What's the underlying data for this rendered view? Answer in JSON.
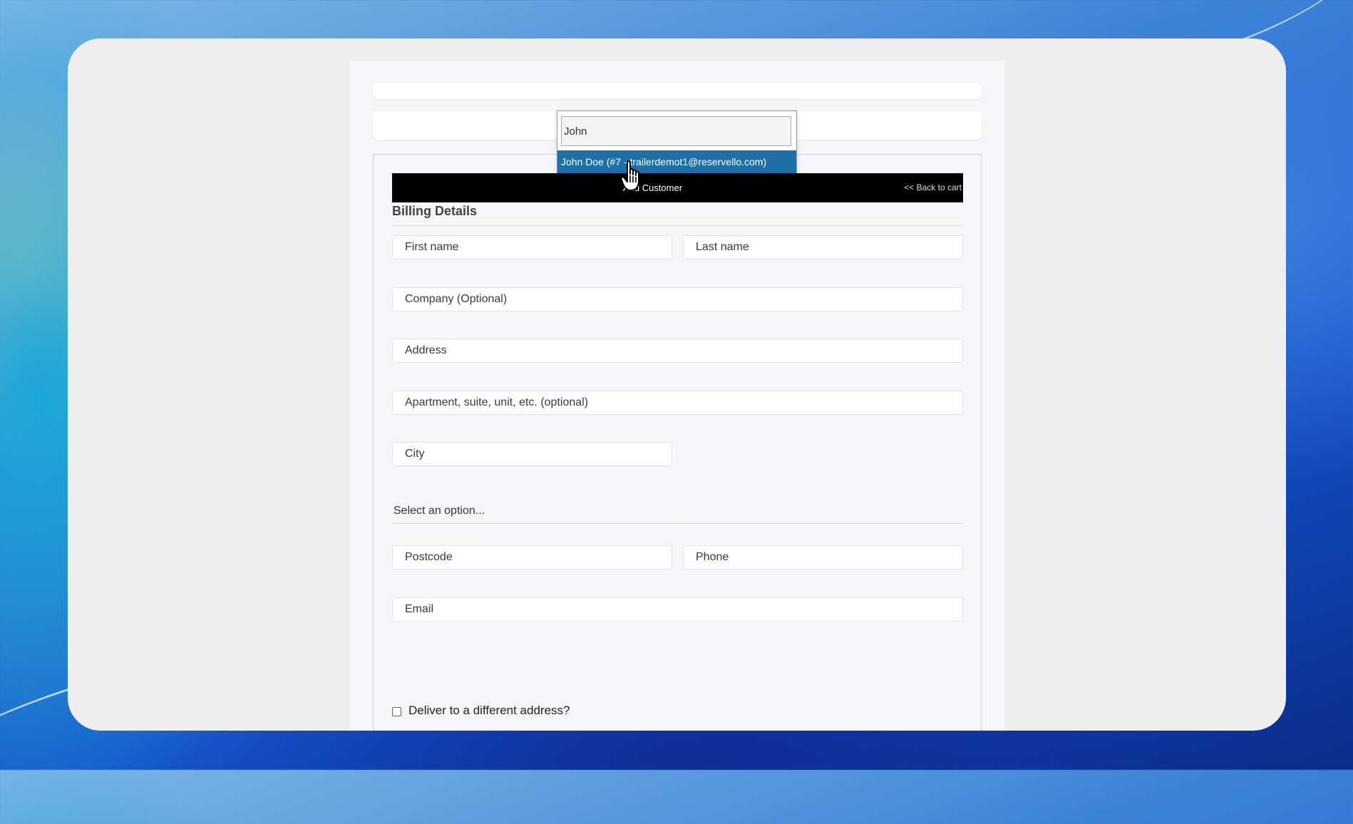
{
  "toolbar": {
    "add_customer_label": "Add Customer",
    "back_to_cart_label": "<< Back to cart"
  },
  "billing": {
    "title": "Billing Details",
    "first_name_placeholder": "First name",
    "last_name_placeholder": "Last name",
    "company_placeholder": "Company (Optional)",
    "address_placeholder": "Address",
    "apartment_placeholder": "Apartment, suite, unit, etc. (optional)",
    "city_placeholder": "City",
    "select_option_label": "Select an option...",
    "postcode_placeholder": "Postcode",
    "phone_placeholder": "Phone",
    "email_placeholder": "Email",
    "deliver_label": "Deliver to a different address?"
  },
  "customer_search": {
    "query": "John",
    "result_label": "John Doe (#7 - trailerdemot1@reservello.com)"
  },
  "icons": {
    "cursor": "hand-pointer-icon"
  }
}
